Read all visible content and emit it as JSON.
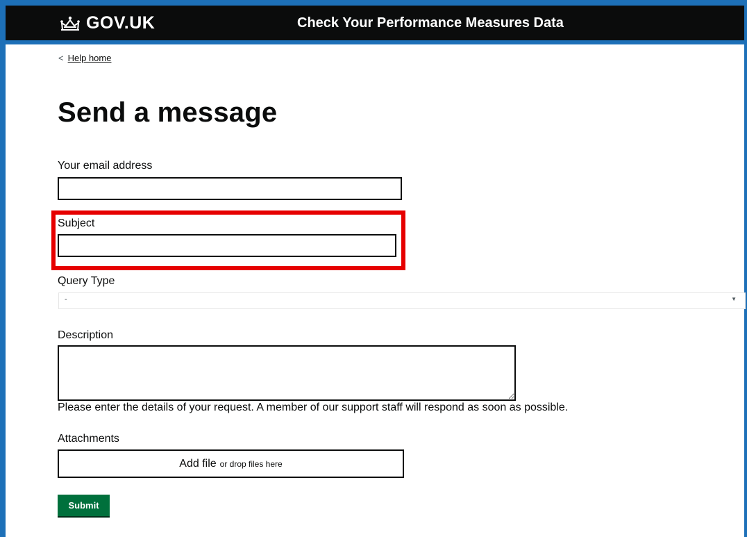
{
  "header": {
    "logo_text": "GOV.UK",
    "logo_icon": "crown-icon",
    "service_name": "Check Your Performance Measures Data",
    "colors": {
      "header_bg": "#0b0c0c",
      "stripe": "#1d70b8"
    }
  },
  "nav": {
    "back_chevron": "<",
    "back_label": "Help home"
  },
  "page": {
    "title": "Send a message"
  },
  "form": {
    "email_label": "Your email address",
    "email_value": "",
    "subject_label": "Subject",
    "subject_value": "",
    "query_type_label": "Query Type",
    "query_type_selected": "-",
    "query_type_arrow": "▼",
    "description_label": "Description",
    "description_value": "",
    "description_hint": "Please enter the details of your request. A member of our support staff will respond as soon as possible.",
    "attachments_label": "Attachments",
    "add_file_label": "Add file",
    "drop_hint": "or drop files here",
    "submit_label": "Submit"
  },
  "colors": {
    "accent": "#1d70b8",
    "highlight": "#e60000",
    "submit_bg": "#00703c"
  }
}
